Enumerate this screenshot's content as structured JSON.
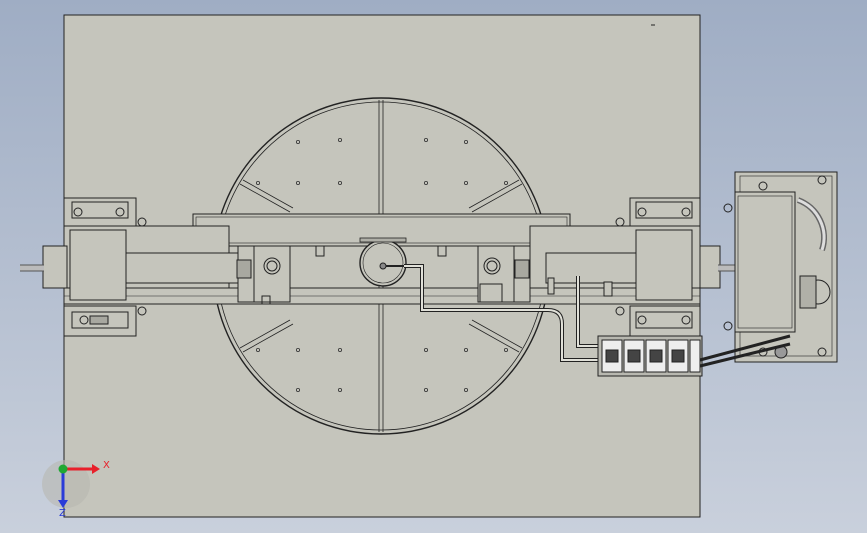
{
  "colors": {
    "background_top": "#9fadc4",
    "background_bottom": "#c9d0dc",
    "plate": "#c5c5bc",
    "line": "#1a1a1a",
    "axis_x": "#e8202a",
    "axis_y": "#1fa832",
    "axis_z": "#2a3cd8"
  },
  "triad": {
    "x_label": "X",
    "z_label": "Z"
  }
}
